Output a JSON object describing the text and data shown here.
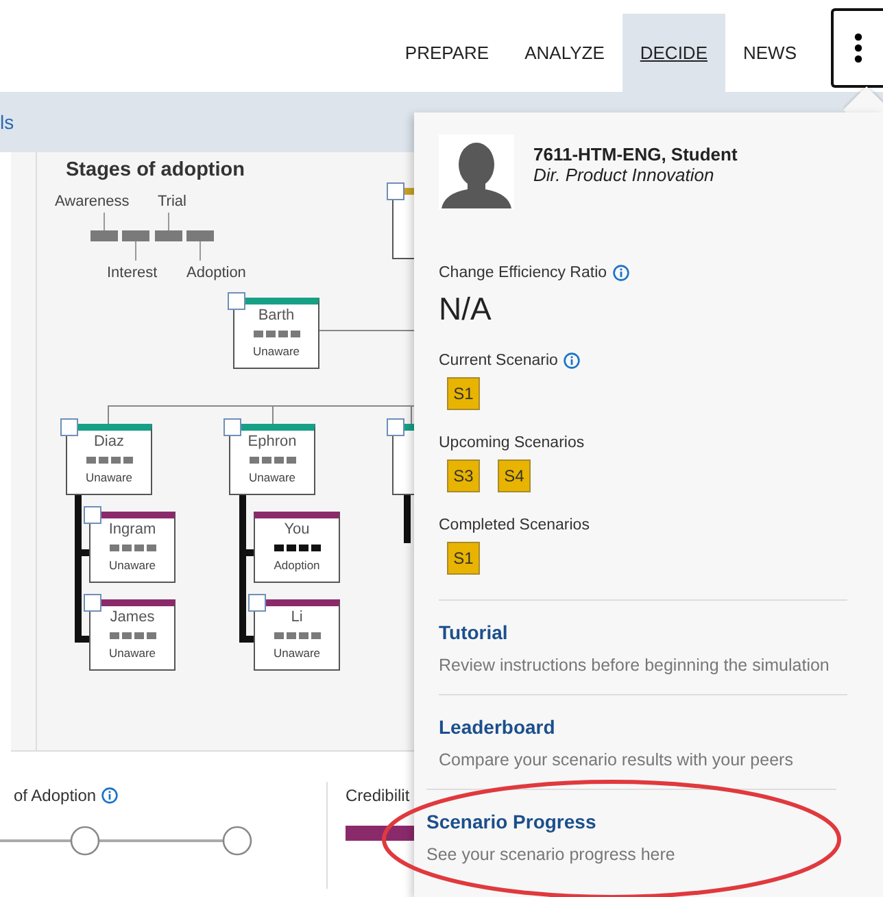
{
  "nav": {
    "tabs": [
      {
        "label": "PREPARE",
        "selected": false
      },
      {
        "label": "ANALYZE",
        "selected": false
      },
      {
        "label": "DECIDE",
        "selected": true
      },
      {
        "label": "NEWS",
        "selected": false
      }
    ]
  },
  "toolbar": {
    "link_text": "ls"
  },
  "diagram": {
    "title": "Stages of adoption",
    "stages": [
      "Awareness",
      "Interest",
      "Trial",
      "Adoption"
    ],
    "nodes": [
      {
        "color": "#c9a227",
        "checked": false,
        "children": [
          {
            "name": "Barth",
            "stage": "Unaware",
            "color": "#17a086",
            "checked": false,
            "active": false,
            "children": [
              {
                "name": "Diaz",
                "stage": "Unaware",
                "color": "#17a086",
                "checked": false,
                "active": false,
                "children": [
                  {
                    "name": "Ingram",
                    "stage": "Unaware",
                    "color": "#8b2a6b",
                    "checked": false,
                    "active": false
                  },
                  {
                    "name": "James",
                    "stage": "Unaware",
                    "color": "#8b2a6b",
                    "checked": false,
                    "active": false
                  }
                ]
              },
              {
                "name": "Ephron",
                "stage": "Unaware",
                "color": "#17a086",
                "checked": false,
                "active": false,
                "children": [
                  {
                    "name": "You",
                    "stage": "Adoption",
                    "color": "#8b2a6b",
                    "active": true
                  },
                  {
                    "name": "Li",
                    "stage": "Unaware",
                    "color": "#8b2a6b",
                    "checked": false,
                    "active": false
                  }
                ]
              },
              {
                "color": "#17a086",
                "checked": false
              }
            ]
          }
        ]
      }
    ]
  },
  "bottom": {
    "stage_label": "of Adoption",
    "stage_info": true,
    "credibility_label": "Credibilit"
  },
  "profile_menu": {
    "name": "7611-HTM-ENG, Student",
    "role": "Dir. Product Innovation",
    "ratio_label": "Change Efficiency Ratio",
    "ratio_info": true,
    "ratio_value": "N/A",
    "scenario_groups": [
      {
        "label": "Current Scenario",
        "info": true,
        "badges": [
          "S1"
        ]
      },
      {
        "label": "Upcoming Scenarios",
        "info": false,
        "badges": [
          "S3",
          "S4"
        ]
      },
      {
        "label": "Completed Scenarios",
        "info": false,
        "badges": [
          "S1"
        ]
      }
    ],
    "links": [
      {
        "title": "Tutorial",
        "description": "Review instructions before beginning the simulation"
      },
      {
        "title": "Leaderboard",
        "description": "Compare your scenario results with your peers"
      },
      {
        "title": "Scenario Progress",
        "description": "See your scenario progress here"
      }
    ]
  }
}
